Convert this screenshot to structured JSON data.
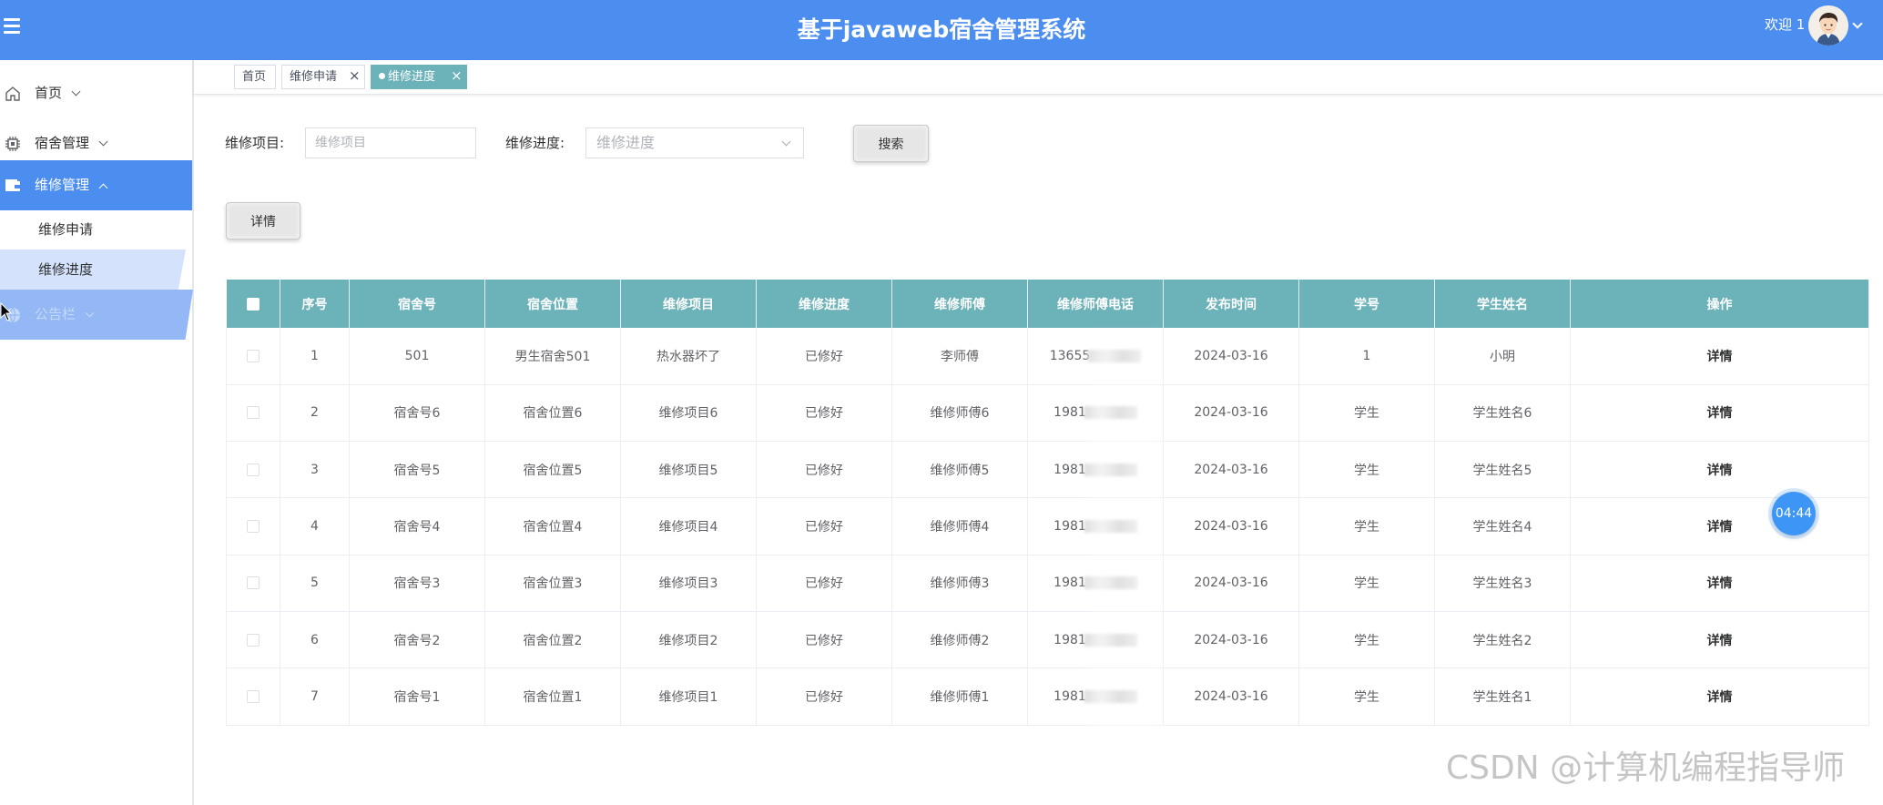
{
  "header": {
    "title": "基于javaweb宿舍管理系统",
    "welcome": "欢迎 1"
  },
  "sidebar": {
    "items": [
      {
        "label": "首页",
        "icon": "home-icon"
      },
      {
        "label": "宿舍管理",
        "icon": "chip-icon"
      },
      {
        "label": "维修管理",
        "icon": "wallet-icon"
      },
      {
        "label": "公告栏",
        "icon": "globe-icon"
      }
    ],
    "sub_items": [
      "维修申请",
      "维修进度"
    ]
  },
  "tabs": [
    {
      "label": "首页"
    },
    {
      "label": "维修申请"
    },
    {
      "label": "维修进度"
    }
  ],
  "search": {
    "project_label": "维修项目:",
    "project_placeholder": "维修项目",
    "progress_label": "维修进度:",
    "progress_placeholder": "维修进度",
    "search_button": "搜索",
    "detail_button": "详情"
  },
  "table": {
    "headers": [
      "序号",
      "宿舍号",
      "宿舍位置",
      "维修项目",
      "维修进度",
      "维修师傅",
      "维修师傅电话",
      "发布时间",
      "学号",
      "学生姓名",
      "操作"
    ],
    "rows": [
      [
        "1",
        "501",
        "男生宿舍501",
        "热水器坏了",
        "已修好",
        "李师傅",
        "13655",
        "2024-03-16",
        "1",
        "小明",
        "详情"
      ],
      [
        "2",
        "宿舍号6",
        "宿舍位置6",
        "维修项目6",
        "已修好",
        "维修师傅6",
        "1981",
        "2024-03-16",
        "学生",
        "学生姓名6",
        "详情"
      ],
      [
        "3",
        "宿舍号5",
        "宿舍位置5",
        "维修项目5",
        "已修好",
        "维修师傅5",
        "1981",
        "2024-03-16",
        "学生",
        "学生姓名5",
        "详情"
      ],
      [
        "4",
        "宿舍号4",
        "宿舍位置4",
        "维修项目4",
        "已修好",
        "维修师傅4",
        "1981",
        "2024-03-16",
        "学生",
        "学生姓名4",
        "详情"
      ],
      [
        "5",
        "宿舍号3",
        "宿舍位置3",
        "维修项目3",
        "已修好",
        "维修师傅3",
        "1981",
        "2024-03-16",
        "学生",
        "学生姓名3",
        "详情"
      ],
      [
        "6",
        "宿舍号2",
        "宿舍位置2",
        "维修项目2",
        "已修好",
        "维修师傅2",
        "1981",
        "2024-03-16",
        "学生",
        "学生姓名2",
        "详情"
      ],
      [
        "7",
        "宿舍号1",
        "宿舍位置1",
        "维修项目1",
        "已修好",
        "维修师傅1",
        "1981",
        "2024-03-16",
        "学生",
        "学生姓名1",
        "详情"
      ]
    ]
  },
  "timer": "04:44",
  "watermark": "CSDN @计算机编程指导师",
  "colors": {
    "header": "#4c8ef0",
    "table_header": "#6cb2b9",
    "active_tab": "#6cb2b9",
    "timer": "#3d96f5"
  }
}
